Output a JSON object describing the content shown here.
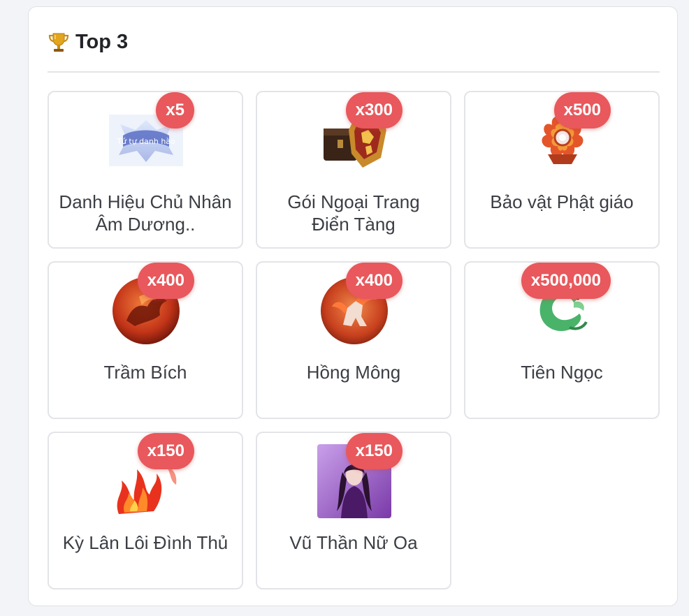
{
  "panel": {
    "title": "Top 3",
    "title_icon": "trophy-icon"
  },
  "colors": {
    "badge_bg": "#e8585c",
    "badge_text": "#ffffff",
    "title_text": "#222428",
    "item_text": "#3b3e44"
  },
  "items": [
    {
      "name": "Danh Hiệu Chủ Nhân Âm Dương..",
      "quantity": "x5",
      "thumb_text": "Tứ tự danh hào",
      "icon": "title-emblem-icon"
    },
    {
      "name": "Gói Ngoại Trang Điển Tàng",
      "quantity": "x300",
      "icon": "costume-chest-icon"
    },
    {
      "name": "Bảo vật Phật giáo",
      "quantity": "x500",
      "icon": "buddhist-relic-icon"
    },
    {
      "name": "Trầm Bích",
      "quantity": "x400",
      "icon": "mount-medallion-icon"
    },
    {
      "name": "Hồng Mông",
      "quantity": "x400",
      "icon": "mount-medallion-icon"
    },
    {
      "name": "Tiên Ngọc",
      "quantity": "x500,000",
      "icon": "jade-dragon-icon"
    },
    {
      "name": "Kỳ Lân Lôi Đình Thủ",
      "quantity": "x150",
      "icon": "flame-effect-icon"
    },
    {
      "name": "Vũ Thần Nữ Oa",
      "quantity": "x150",
      "icon": "goddess-portrait-icon"
    }
  ]
}
